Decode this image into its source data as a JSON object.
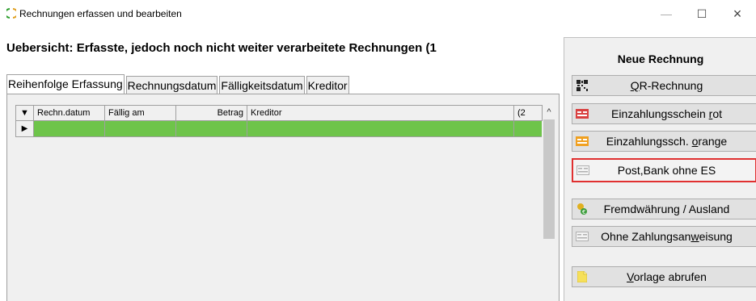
{
  "window": {
    "title": "Rechnungen erfassen und bearbeiten",
    "controls": {
      "minimize": "—",
      "maximize": "☐",
      "close": "×"
    }
  },
  "overview": {
    "title": "Uebersicht: Erfasste, jedoch noch nicht weiter verarbeitete Rechnungen (1"
  },
  "tabs": [
    {
      "label": "Reihenfolge Erfassung",
      "active": true
    },
    {
      "label": "Rechnungsdatum",
      "active": false
    },
    {
      "label": "Fälligkeitsdatum",
      "active": false
    },
    {
      "label": "Kreditor",
      "active": false
    }
  ],
  "grid": {
    "indicator_header": "▼",
    "columns": [
      "Rechn.datum",
      "Fällig am",
      "Betrag",
      "Kreditor",
      "(2"
    ],
    "rows": [
      {
        "indicator": "▶",
        "cells": [
          "",
          "",
          "",
          "",
          ""
        ],
        "highlight_color": "#6ec44a"
      }
    ],
    "scroll_up": "^"
  },
  "right_panel": {
    "heading": "Neue Rechnung",
    "buttons": [
      {
        "pre": "",
        "ul": "Q",
        "post": "R-Rechnung",
        "icon": "qr-code-icon"
      },
      {
        "pre": "Einzahlungsschein ",
        "ul": "r",
        "post": "ot",
        "icon": "red-slip-icon"
      },
      {
        "pre": "Einzahlungssch. ",
        "ul": "o",
        "post": "range",
        "icon": "orange-slip-icon"
      },
      {
        "pre": "Post,Bank ohne ES",
        "ul": "",
        "post": "",
        "icon": "gray-slip-icon"
      },
      {
        "pre": "Fremdwährung / Ausland",
        "ul": "",
        "post": "",
        "icon": "currency-icon"
      },
      {
        "pre": "Ohne Zahlungsan",
        "ul": "w",
        "post": "eisung",
        "icon": "gray-slip-icon"
      },
      {
        "pre": "",
        "ul": "V",
        "post": "orlage abrufen",
        "icon": "template-icon"
      }
    ]
  }
}
